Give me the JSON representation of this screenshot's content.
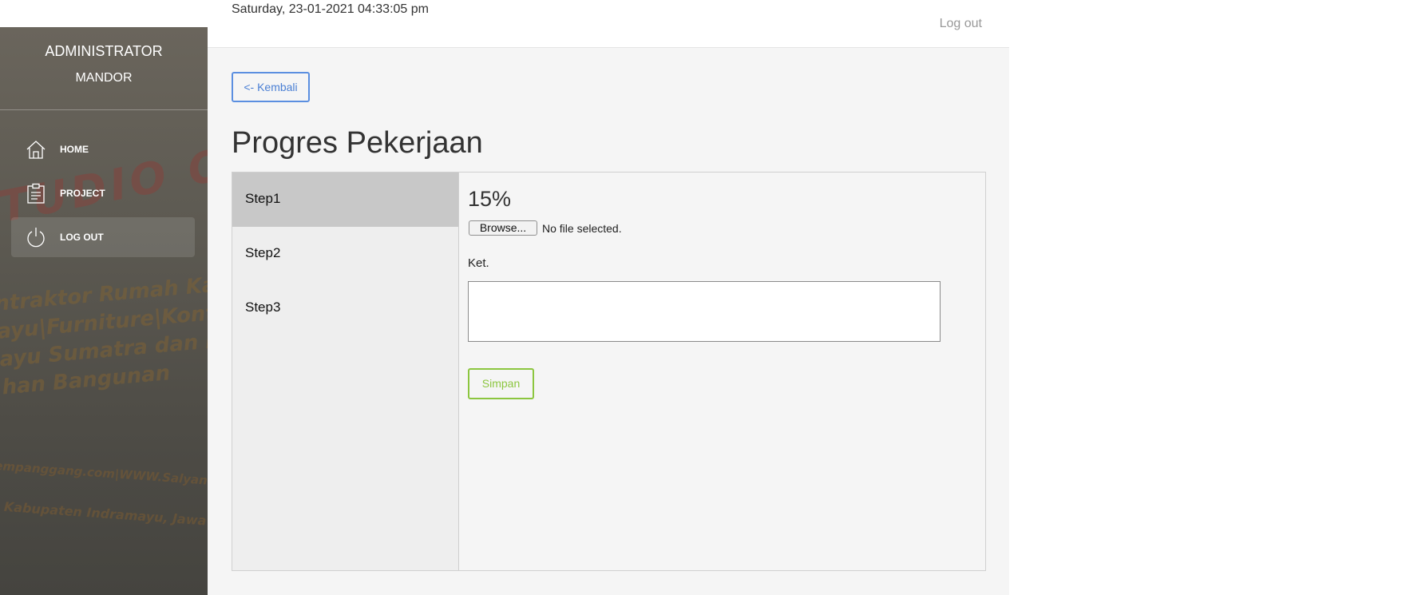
{
  "header": {
    "datetime": "Saturday, 23-01-2021 04:33:05 pm",
    "logout_label": "Log out"
  },
  "sidebar": {
    "title": "ADMINISTRATOR",
    "role": "MANDOR",
    "items": [
      {
        "label": "HOME",
        "icon": "home-icon"
      },
      {
        "label": "PROJECT",
        "icon": "clipboard-icon"
      },
      {
        "label": "LOG OUT",
        "icon": "power-icon"
      }
    ],
    "watermark": {
      "line1": "TUDIO OPTI",
      "line2": "ntraktor Rumah Ka",
      "line3": "ayu|Furniture|Kontruksi",
      "line4": "ayu Sumatra dan Kalima",
      "line5": "han Bangunan",
      "line6": "empanggang.com|WWW.Salyan-Kontr",
      "line7": ", Kabupaten Indramayu, Jawa Barat"
    }
  },
  "main": {
    "back_label": "<- Kembali",
    "title": "Progres Pekerjaan",
    "steps": [
      "Step1",
      "Step2",
      "Step3"
    ],
    "active_step": "Step1",
    "progress_text": "15%",
    "file": {
      "button_label": "Browse...",
      "status": "No file selected."
    },
    "ket_label": "Ket.",
    "ket_value": "",
    "save_label": "Simpan"
  },
  "colors": {
    "accent_blue": "#5b8fe0",
    "accent_green": "#8cc63f",
    "sidebar_bg": "#5d5a52"
  }
}
